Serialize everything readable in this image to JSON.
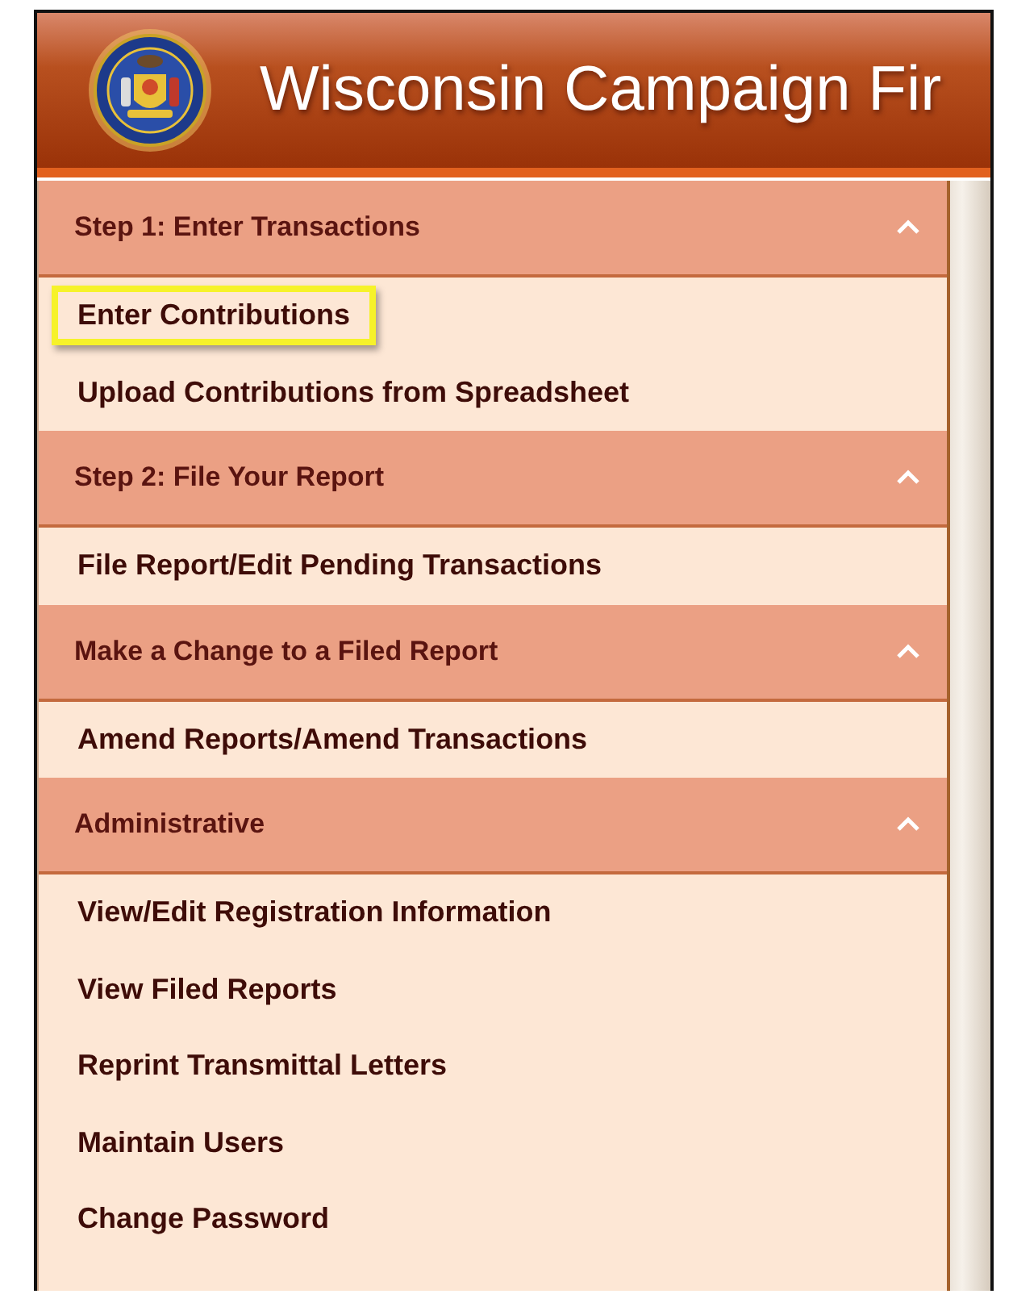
{
  "header": {
    "title": "Wisconsin Campaign Fir"
  },
  "sections": [
    {
      "title": "Step 1: Enter Transactions",
      "expanded": true,
      "items": [
        {
          "label": "Enter Contributions",
          "highlighted": true
        },
        {
          "label": "Upload Contributions from Spreadsheet",
          "highlighted": false
        }
      ]
    },
    {
      "title": "Step 2: File Your Report",
      "expanded": true,
      "items": [
        {
          "label": "File Report/Edit Pending Transactions",
          "highlighted": false
        }
      ]
    },
    {
      "title": "Make a Change to a Filed Report",
      "expanded": true,
      "items": [
        {
          "label": "Amend Reports/Amend Transactions",
          "highlighted": false
        }
      ]
    },
    {
      "title": "Administrative",
      "expanded": true,
      "items": [
        {
          "label": "View/Edit Registration Information",
          "highlighted": false
        },
        {
          "label": "View Filed Reports",
          "highlighted": false
        },
        {
          "label": "Reprint Transmittal Letters",
          "highlighted": false
        },
        {
          "label": "Maintain Users",
          "highlighted": false
        },
        {
          "label": "Change Password",
          "highlighted": false
        }
      ]
    }
  ]
}
